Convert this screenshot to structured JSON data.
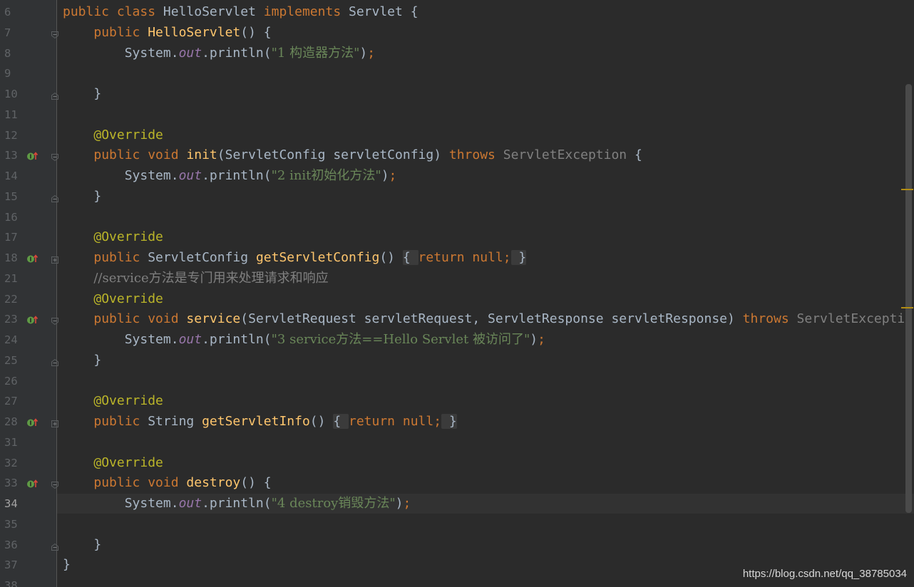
{
  "editor": {
    "lines": [
      {
        "no": "6",
        "tokens": [
          [
            "kw",
            "public class "
          ],
          [
            "",
            "HelloServlet "
          ],
          [
            "kw",
            "implements "
          ],
          [
            "",
            "Servlet {"
          ]
        ]
      },
      {
        "no": "7",
        "tokens": [
          [
            "",
            "    "
          ],
          [
            "kw",
            "public "
          ],
          [
            "fn",
            "HelloServlet"
          ],
          [
            "",
            "() {"
          ]
        ]
      },
      {
        "no": "8",
        "tokens": [
          [
            "",
            "        System."
          ],
          [
            "it",
            "out"
          ],
          [
            "",
            ".println("
          ],
          [
            "st",
            "\"1 构造器方法\""
          ],
          [
            "",
            ")"
          ],
          [
            "kw",
            ";"
          ]
        ]
      },
      {
        "no": "9",
        "tokens": []
      },
      {
        "no": "10",
        "tokens": [
          [
            "",
            "    }"
          ]
        ]
      },
      {
        "no": "11",
        "tokens": []
      },
      {
        "no": "12",
        "tokens": [
          [
            "",
            "    "
          ],
          [
            "an",
            "@Override"
          ]
        ]
      },
      {
        "no": "13",
        "tokens": [
          [
            "",
            "    "
          ],
          [
            "kw",
            "public void "
          ],
          [
            "fn",
            "init"
          ],
          [
            "",
            "(ServletConfig servletConfig) "
          ],
          [
            "kw",
            "throws "
          ],
          [
            "gy",
            "ServletException "
          ],
          [
            "",
            "{"
          ]
        ]
      },
      {
        "no": "14",
        "tokens": [
          [
            "",
            "        System."
          ],
          [
            "it",
            "out"
          ],
          [
            "",
            ".println("
          ],
          [
            "st",
            "\"2 init初始化方法\""
          ],
          [
            "",
            ")"
          ],
          [
            "kw",
            ";"
          ]
        ]
      },
      {
        "no": "15",
        "tokens": [
          [
            "",
            "    }"
          ]
        ]
      },
      {
        "no": "16",
        "tokens": []
      },
      {
        "no": "17",
        "tokens": [
          [
            "",
            "    "
          ],
          [
            "an",
            "@Override"
          ]
        ]
      },
      {
        "no": "18",
        "tokens": [
          [
            "",
            "    "
          ],
          [
            "kw",
            "public "
          ],
          [
            "",
            "ServletConfig "
          ],
          [
            "fn",
            "getServletConfig"
          ],
          [
            "",
            "() "
          ],
          [
            "fb",
            "{ "
          ],
          [
            "kw",
            "return null;"
          ],
          [
            "fb",
            " }"
          ]
        ]
      },
      {
        "no": "21",
        "tokens": [
          [
            "",
            "    "
          ],
          [
            "cm",
            "//service方法是专门用来处理请求和响应"
          ]
        ]
      },
      {
        "no": "22",
        "tokens": [
          [
            "",
            "    "
          ],
          [
            "an",
            "@Override"
          ]
        ]
      },
      {
        "no": "23",
        "tokens": [
          [
            "",
            "    "
          ],
          [
            "kw",
            "public void "
          ],
          [
            "fn",
            "service"
          ],
          [
            "",
            "(ServletRequest servletRequest, ServletResponse servletResponse) "
          ],
          [
            "kw",
            "throws "
          ],
          [
            "gy",
            "ServletExcepti"
          ]
        ]
      },
      {
        "no": "24",
        "tokens": [
          [
            "",
            "        System."
          ],
          [
            "it",
            "out"
          ],
          [
            "",
            ".println("
          ],
          [
            "st",
            "\"3 service方法==Hello Servlet 被访问了\""
          ],
          [
            "",
            ")"
          ],
          [
            "kw",
            ";"
          ]
        ]
      },
      {
        "no": "25",
        "tokens": [
          [
            "",
            "    }"
          ]
        ]
      },
      {
        "no": "26",
        "tokens": []
      },
      {
        "no": "27",
        "tokens": [
          [
            "",
            "    "
          ],
          [
            "an",
            "@Override"
          ]
        ]
      },
      {
        "no": "28",
        "tokens": [
          [
            "",
            "    "
          ],
          [
            "kw",
            "public "
          ],
          [
            "",
            "String "
          ],
          [
            "fn",
            "getServletInfo"
          ],
          [
            "",
            "() "
          ],
          [
            "fb",
            "{ "
          ],
          [
            "kw",
            "return null;"
          ],
          [
            "fb",
            " }"
          ]
        ]
      },
      {
        "no": "31",
        "tokens": []
      },
      {
        "no": "32",
        "tokens": [
          [
            "",
            "    "
          ],
          [
            "an",
            "@Override"
          ]
        ]
      },
      {
        "no": "33",
        "tokens": [
          [
            "",
            "    "
          ],
          [
            "kw",
            "public void "
          ],
          [
            "fn",
            "destroy"
          ],
          [
            "",
            "() {"
          ]
        ]
      },
      {
        "no": "34",
        "tokens": [
          [
            "",
            "        System."
          ],
          [
            "it",
            "out"
          ],
          [
            "",
            ".println("
          ],
          [
            "st",
            "\"4 destroy销毁方法\""
          ],
          [
            "",
            ")"
          ],
          [
            "kw",
            ";"
          ]
        ]
      },
      {
        "no": "35",
        "tokens": []
      },
      {
        "no": "36",
        "tokens": [
          [
            "",
            "    }"
          ]
        ]
      },
      {
        "no": "37",
        "tokens": [
          [
            "",
            "}"
          ]
        ]
      },
      {
        "no": "38",
        "tokens": []
      }
    ],
    "current_line": "34",
    "implements_markers_on": [
      "13",
      "18",
      "23",
      "28",
      "33"
    ],
    "fold_markers": {
      "7": "open",
      "10": "close",
      "13": "open",
      "15": "close",
      "18": "plus",
      "23": "open",
      "25": "close",
      "28": "plus",
      "33": "open",
      "36": "close"
    }
  },
  "colors": {
    "background": "#2b2b2b",
    "keyword": "#cc7832",
    "method": "#ffc66d",
    "annotation": "#bbb529",
    "string": "#6a8759",
    "static_field": "#9876aa",
    "comment": "#808080"
  },
  "watermark": "https://blog.csdn.net/qq_38785034"
}
